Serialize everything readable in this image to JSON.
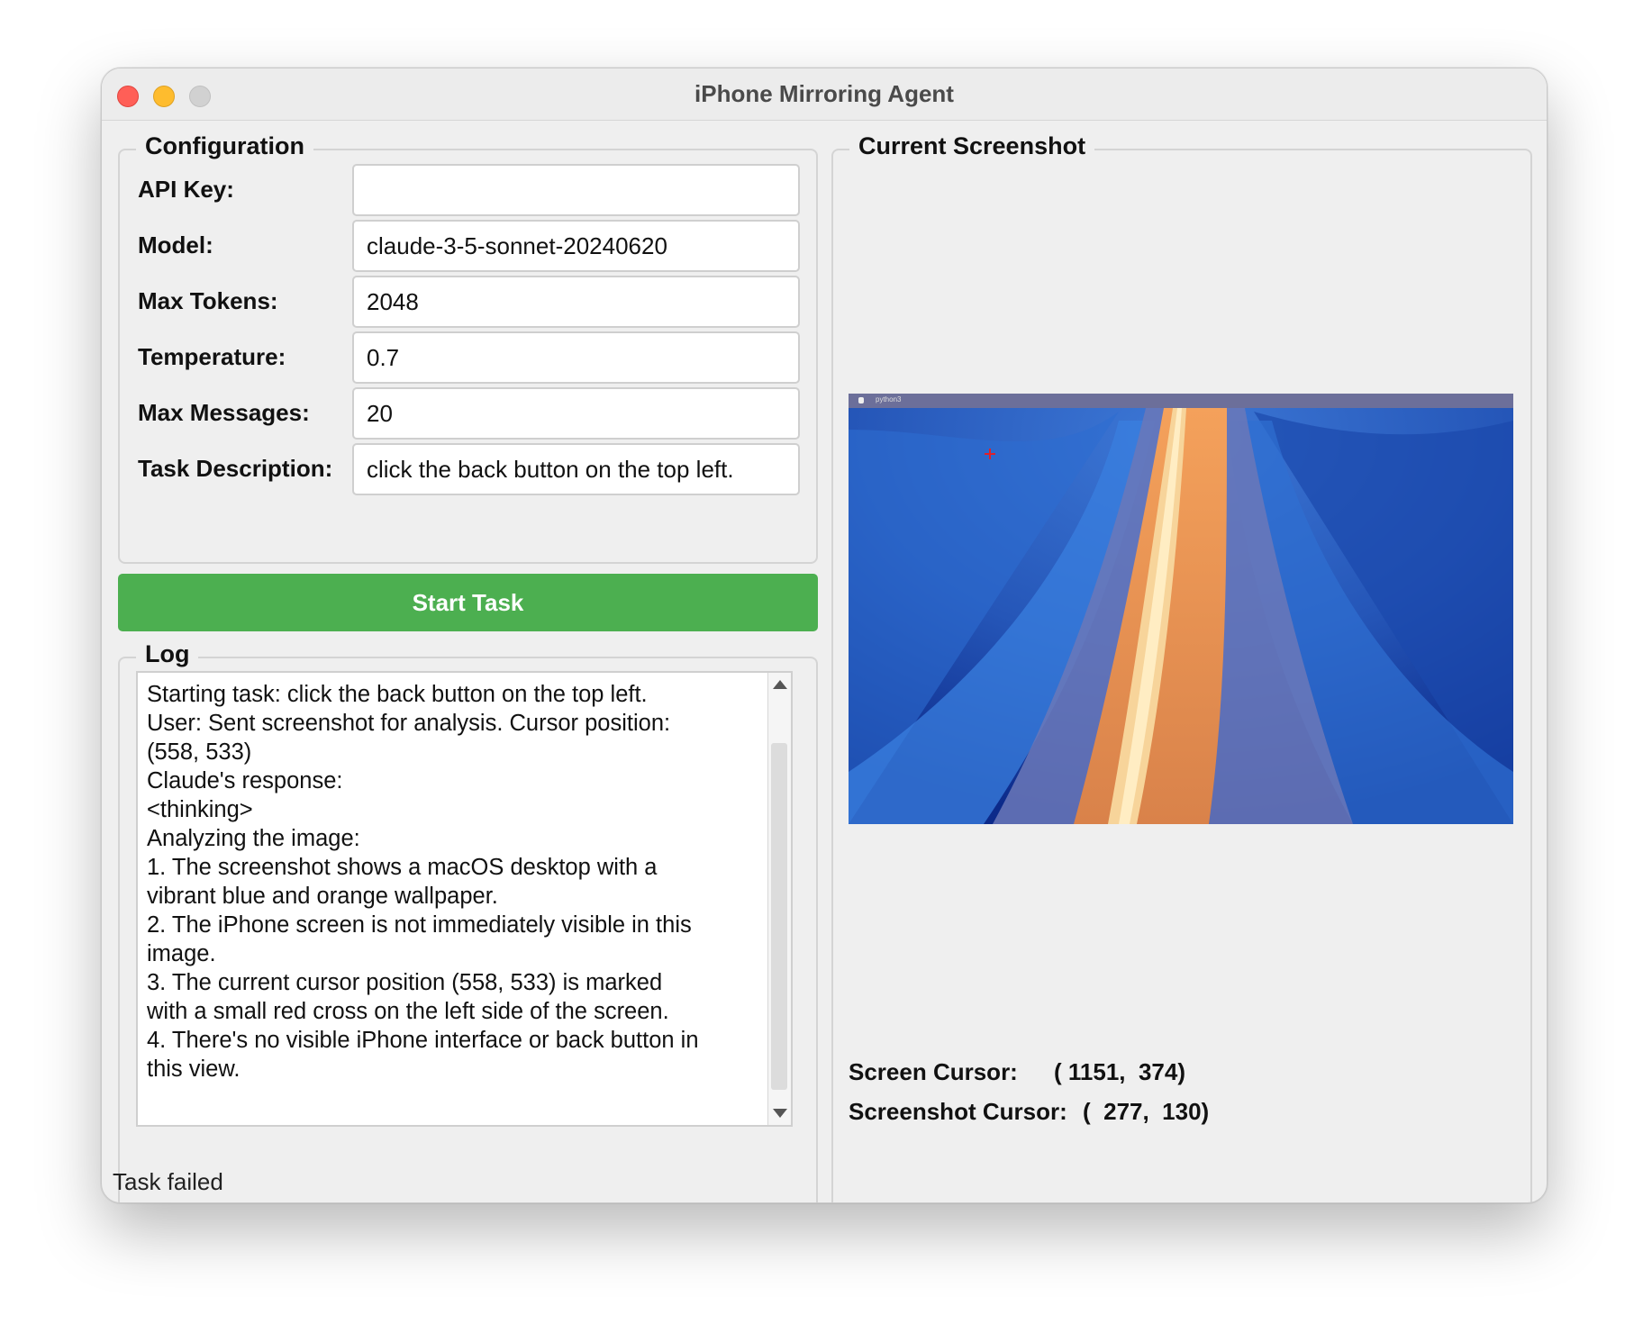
{
  "window": {
    "title": "iPhone Mirroring Agent"
  },
  "config": {
    "title": "Configuration",
    "fields": [
      {
        "label": "API Key:",
        "value": ""
      },
      {
        "label": "Model:",
        "value": "claude-3-5-sonnet-20240620"
      },
      {
        "label": "Max Tokens:",
        "value": "2048"
      },
      {
        "label": "Temperature:",
        "value": "0.7"
      },
      {
        "label": "Max Messages:",
        "value": "20"
      },
      {
        "label": "Task Description:",
        "value": "click the back button on the top left."
      }
    ]
  },
  "start_button": {
    "label": "Start Task"
  },
  "log": {
    "title": "Log",
    "lines": [
      "Starting task: click the back button on the top left.",
      "User: Sent screenshot for analysis. Cursor position:",
      "(558, 533)",
      "Claude's response:",
      "<thinking>",
      "Analyzing the image:",
      "1. The screenshot shows a macOS desktop with a",
      "vibrant blue and orange wallpaper.",
      "2. The iPhone screen is not immediately visible in this",
      "image.",
      "3. The current cursor position (558, 533) is marked",
      "with a small red cross on the left side of the screen.",
      "4. There's no visible iPhone interface or back button in",
      "this view."
    ]
  },
  "screenshot": {
    "title": "Current Screenshot",
    "menubar_text": "python3",
    "screen_cursor_label": "Screen Cursor:",
    "screen_cursor_value": "( 1151,  374)",
    "screenshot_cursor_label": "Screenshot Cursor:",
    "screenshot_cursor_value": "(  277,  130)"
  },
  "status": {
    "text": "Task failed"
  },
  "colors": {
    "start_button": "#4caf50",
    "close": "#ff5f57",
    "minimize": "#febc2e",
    "cursor_marker": "#e0202b"
  }
}
